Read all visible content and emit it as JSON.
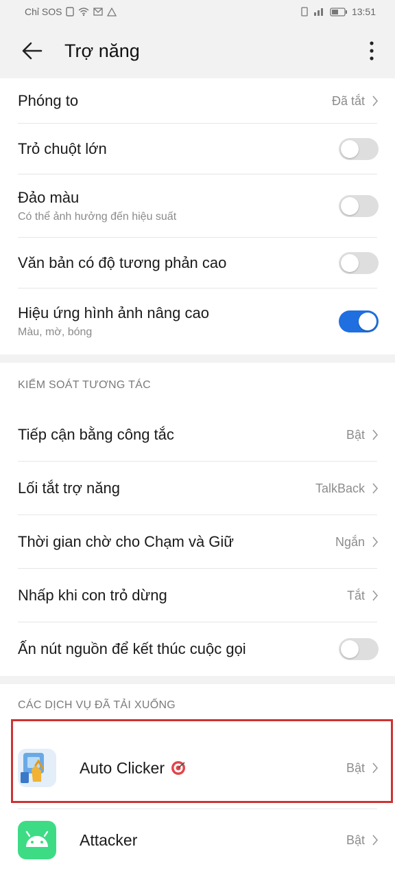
{
  "status_bar": {
    "carrier": "Chỉ SOS",
    "time": "13:51"
  },
  "header": {
    "title": "Trợ năng"
  },
  "display_settings": [
    {
      "label": "Phóng to",
      "value": "Đã tắt"
    },
    {
      "label": "Trỏ chuột lớn",
      "toggle": false
    },
    {
      "label": "Đảo màu",
      "subtitle": "Có thể ảnh hưởng đến hiệu suất",
      "toggle": false
    },
    {
      "label": "Văn bản có độ tương phản cao",
      "toggle": false
    },
    {
      "label": "Hiệu ứng hình ảnh nâng cao",
      "subtitle": "Màu, mờ, bóng",
      "toggle": true
    }
  ],
  "interaction": {
    "header": "KIỂM SOÁT TƯƠNG TÁC",
    "items": [
      {
        "label": "Tiếp cận bằng công tắc",
        "value": "Bật"
      },
      {
        "label": "Lối tắt trợ năng",
        "value": "TalkBack"
      },
      {
        "label": "Thời gian chờ cho Chạm và Giữ",
        "value": "Ngắn"
      },
      {
        "label": "Nhấp khi con trỏ dừng",
        "value": "Tắt"
      },
      {
        "label": "Ấn nút nguồn để kết thúc cuộc gọi",
        "toggle": false
      }
    ]
  },
  "downloaded": {
    "header": "CÁC DỊCH VỤ ĐÃ TẢI XUỐNG",
    "items": [
      {
        "name": "Auto Clicker",
        "value": "Bật",
        "icon": "auto-clicker-icon"
      },
      {
        "name": "Attacker",
        "value": "Bật",
        "icon": "android-icon"
      }
    ]
  },
  "colors": {
    "toggle_on": "#1f6fe0",
    "highlight_border": "#cc3333"
  }
}
